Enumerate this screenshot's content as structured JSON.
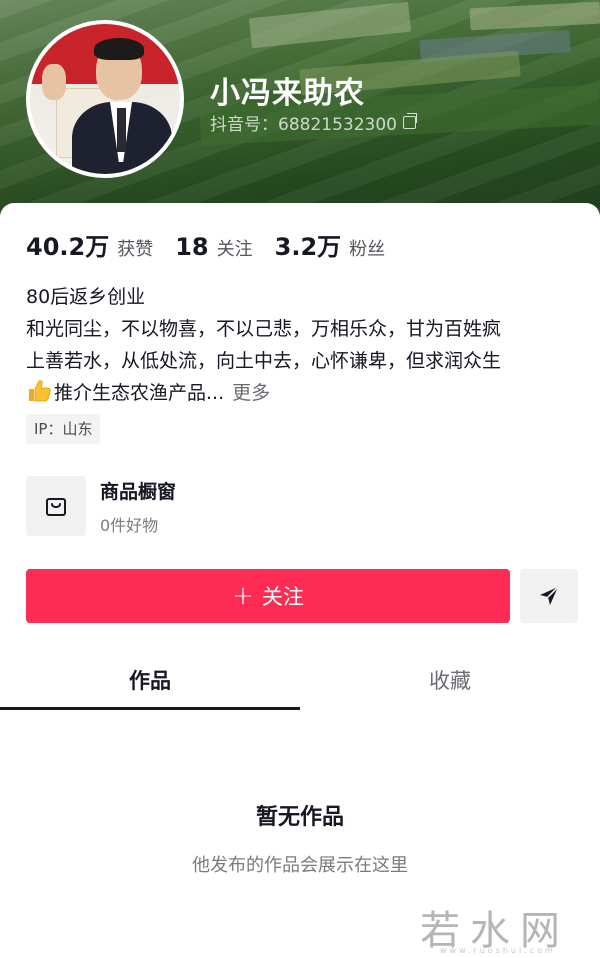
{
  "profile": {
    "name": "小冯来助农",
    "douyin_id": "抖音号：68821532300"
  },
  "stats": [
    {
      "num": "40.2万",
      "label": "获赞"
    },
    {
      "num": "18",
      "label": "关注"
    },
    {
      "num": "3.2万",
      "label": "粉丝"
    }
  ],
  "bio": {
    "line1": "80后返乡创业",
    "line2": "和光同尘，不以物喜，不以己悲，万相乐众，甘为百姓疯",
    "line3": "上善若水，从低处流，向土中去，心怀谦卑，但求润众生",
    "line4": "推介生态农渔产品...",
    "more": "更多"
  },
  "ip_tag": "IP：山东",
  "shop": {
    "title": "商品橱窗",
    "subtitle": "0件好物"
  },
  "actions": {
    "follow_label": "关注",
    "follow_plus": "+"
  },
  "tabs": [
    {
      "label": "作品"
    },
    {
      "label": "收藏"
    }
  ],
  "empty": {
    "title": "暂无作品",
    "subtitle": "他发布的作品会展示在这里"
  },
  "watermark": {
    "text": "若水网",
    "small": "www.ruoshui.com"
  },
  "colors": {
    "accent": "#fe2c55",
    "text": "#161823"
  }
}
